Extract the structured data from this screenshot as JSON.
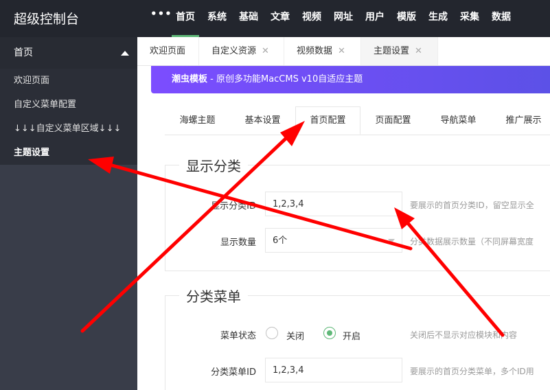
{
  "app": {
    "title": "超级控制台",
    "more": "•••"
  },
  "topnav": [
    "首页",
    "系统",
    "基础",
    "文章",
    "视频",
    "网址",
    "用户",
    "模版",
    "生成",
    "采集",
    "数据"
  ],
  "sidebar": {
    "head": "首页",
    "items": [
      "欢迎页面",
      "自定义菜单配置",
      "↓↓↓自定义菜单区域↓↓↓",
      "主题设置"
    ]
  },
  "tabs": [
    {
      "label": "欢迎页面",
      "close": ""
    },
    {
      "label": "自定义资源",
      "close": "✕"
    },
    {
      "label": "视频数据",
      "close": "✕"
    },
    {
      "label": "主题设置",
      "close": "✕"
    }
  ],
  "banner": {
    "name": "潮虫模板",
    "desc": " - 原创多功能MacCMS v10自适应主题"
  },
  "subtabs": [
    "海螺主题",
    "基本设置",
    "首页配置",
    "页面配置",
    "导航菜单",
    "推广展示"
  ],
  "section1": {
    "title": "显示分类",
    "fields": [
      {
        "label": "显示分类ID",
        "value": "1,2,3,4",
        "hint": "要展示的首页分类ID，留空显示全"
      },
      {
        "label": "显示数量",
        "value": "6个",
        "hint": "分类数据展示数量（不同屏幕宽度"
      }
    ]
  },
  "section2": {
    "title": "分类菜单",
    "status_label": "菜单状态",
    "options": [
      "关闭",
      "开启"
    ],
    "status_hint": "关闭后不显示对应模块和内容",
    "menu_label": "分类菜单ID",
    "menu_value": "1,2,3,4",
    "menu_hint": "要展示的首页分类菜单，多个ID用"
  },
  "colors": {
    "accent": "#5fb878",
    "arrow": "#ff0000",
    "topbar": "#23262e",
    "sidebar": "#393d49"
  }
}
